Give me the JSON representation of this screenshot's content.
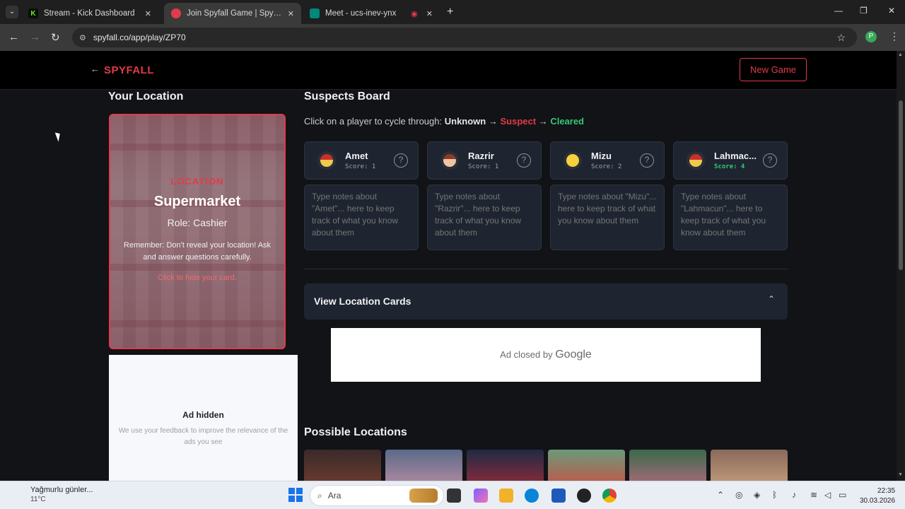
{
  "browser": {
    "tabs": [
      {
        "title": "Stream - Kick Dashboard",
        "favicon": "K",
        "color": "#53fc18",
        "active": false
      },
      {
        "title": "Join Spyfall Game | Spyfall Onli",
        "favicon": "",
        "color": "#e23a4a",
        "active": true
      },
      {
        "title": "Meet - ucs-inev-ynx",
        "favicon": "",
        "color": "#00897b",
        "active": false
      }
    ],
    "url": "spyfall.co/app/play/ZP70",
    "profile_initial": "P"
  },
  "header": {
    "logo": "SPYFALL",
    "new_game": "New Game"
  },
  "location": {
    "section_title": "Your Location",
    "label": "LOCATION",
    "name": "Supermarket",
    "role": "Role: Cashier",
    "reminder": "Remember: Don't reveal your location! Ask and answer questions carefully.",
    "hide": "Click to hide your card."
  },
  "ad_hidden": {
    "title": "Ad hidden",
    "subtitle": "We use your feedback to improve the relevance of the ads you see"
  },
  "suspects": {
    "section_title": "Suspects Board",
    "instruction_prefix": "Click on a player to cycle through:",
    "state_unknown": "Unknown",
    "arrow": "→",
    "state_suspect": "Suspect",
    "state_cleared": "Cleared",
    "players": [
      {
        "name": "Amet",
        "score": "Score: 1",
        "note": "Type notes about \"Amet\"... here to keep track of what you know about them"
      },
      {
        "name": "Razrir",
        "score": "Score: 1",
        "note": "Type notes about \"Razrir\"... here to keep track of what you know about them"
      },
      {
        "name": "Mizu",
        "score": "Score: 2",
        "note": "Type notes about \"Mizu\"... here to keep track of what you know about them"
      },
      {
        "name": "Lahmac...",
        "score": "Score: 4",
        "note": "Type notes about \"Lahmacun\"... here to keep track of what you know about them"
      }
    ]
  },
  "view_location_cards": "View Location Cards",
  "ad_closed": {
    "prefix": "Ad closed by",
    "brand": "Google"
  },
  "possible_locations": {
    "title": "Possible Locations"
  },
  "taskbar": {
    "weather_text": "Yağmurlu günler...",
    "weather_temp": "11°C",
    "search_placeholder": "Ara",
    "time": "22:35",
    "date": "30.03.2026"
  },
  "colors": {
    "accent": "#e23a4a",
    "cleared": "#37c871"
  }
}
